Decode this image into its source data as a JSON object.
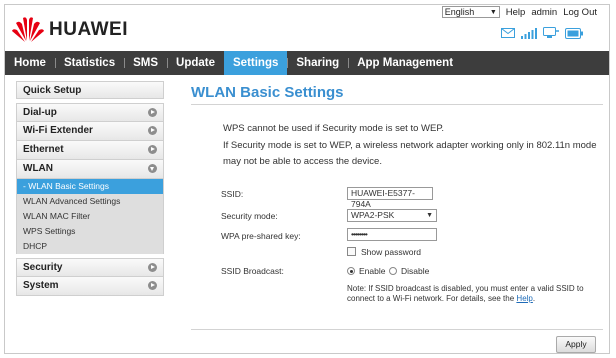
{
  "header": {
    "brand": "HUAWEI",
    "language": "English",
    "links": {
      "help": "Help",
      "user": "admin",
      "logout": "Log Out"
    },
    "status_icons": [
      "envelope-icon",
      "signal-icon",
      "connected-screen-icon",
      "battery-icon"
    ]
  },
  "nav": {
    "items": [
      {
        "label": "Home",
        "active": false
      },
      {
        "label": "Statistics",
        "active": false
      },
      {
        "label": "SMS",
        "active": false
      },
      {
        "label": "Update",
        "active": false
      },
      {
        "label": "Settings",
        "active": true
      },
      {
        "label": "Sharing",
        "active": false
      },
      {
        "label": "App Management",
        "active": false
      }
    ]
  },
  "sidebar": {
    "quick_setup": "Quick Setup",
    "groups_top": [
      {
        "label": "Dial-up"
      },
      {
        "label": "Wi-Fi Extender"
      },
      {
        "label": "Ethernet"
      }
    ],
    "wlan": {
      "label": "WLAN",
      "items": [
        {
          "label": "- WLAN Basic Settings",
          "active": true
        },
        {
          "label": "WLAN Advanced Settings",
          "active": false
        },
        {
          "label": "WLAN MAC Filter",
          "active": false
        },
        {
          "label": "WPS Settings",
          "active": false
        },
        {
          "label": "DHCP",
          "active": false
        }
      ]
    },
    "groups_bottom": [
      {
        "label": "Security"
      },
      {
        "label": "System"
      }
    ]
  },
  "main": {
    "title": "WLAN Basic Settings",
    "warning_line1": "WPS cannot be used if Security mode is set to WEP.",
    "warning_line2": "If Security mode is set to WEP, a wireless network adapter working only in 802.11n mode may not be able to access the device.",
    "form": {
      "ssid_label": "SSID:",
      "ssid_value": "HUAWEI-E5377-794A",
      "security_label": "Security mode:",
      "security_value": "WPA2-PSK",
      "psk_label": "WPA pre-shared key:",
      "psk_value": "••••••••",
      "show_password": "Show password",
      "broadcast_label": "SSID Broadcast:",
      "enable": "Enable",
      "disable": "Disable",
      "note_text": "Note: If SSID broadcast is disabled, you must enter a valid SSID to connect to a Wi-Fi network. For details, see the",
      "note_link": "Help",
      "note_end": "."
    },
    "apply": "Apply"
  },
  "colors": {
    "accent": "#3ba0dd",
    "nav_bg": "#3d3d3d",
    "title": "#3a8fd0",
    "logo": "#e60012"
  }
}
